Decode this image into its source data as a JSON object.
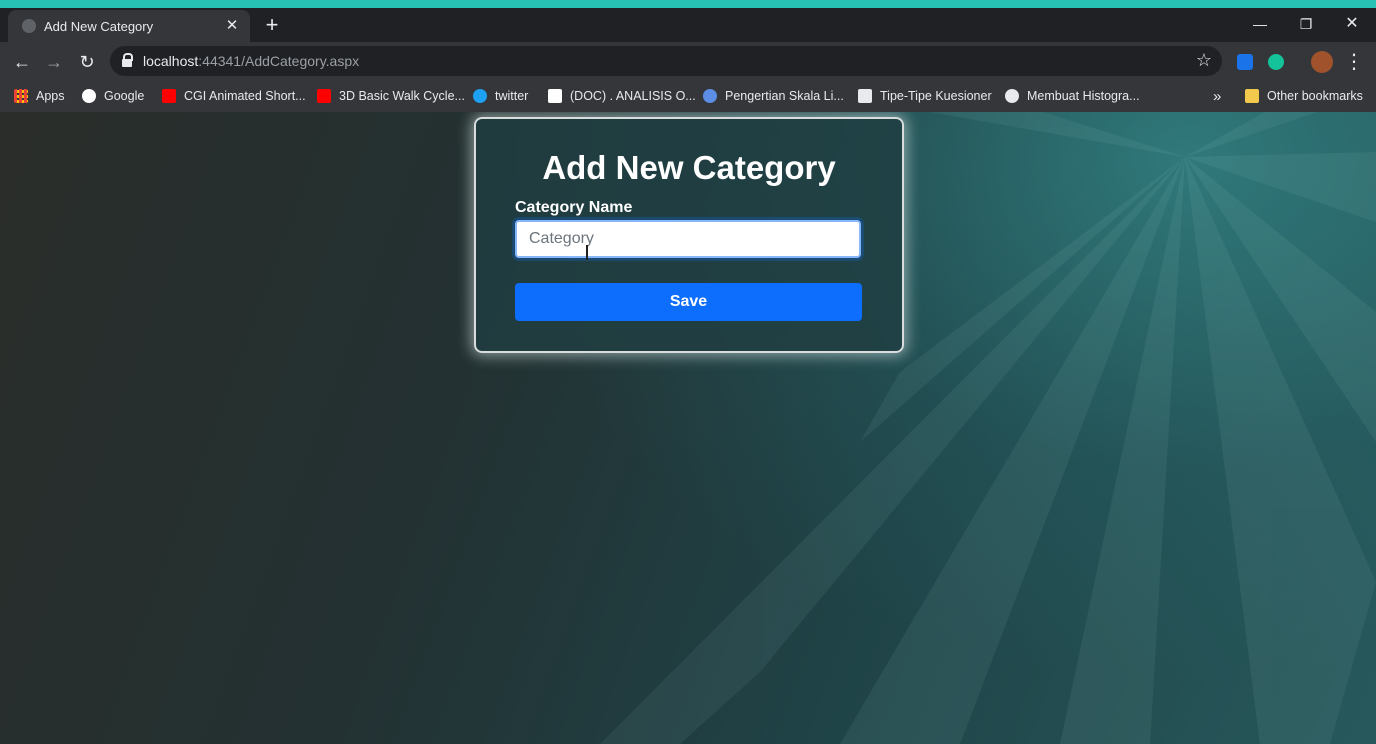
{
  "colors": {
    "top_band": "#28c2b4",
    "accent": "#0d6efd",
    "tabstrip": "#202124",
    "toolbar": "#35363a"
  },
  "browser": {
    "tab": {
      "title": "Add New Category",
      "favicon": "globe-icon",
      "close_label": "✕"
    },
    "new_tab_label": "+",
    "window_controls": {
      "minimize": "—",
      "restore": "❐",
      "close": "✕"
    },
    "nav": {
      "back": "←",
      "forward": "→",
      "reload": "↻"
    },
    "address": {
      "host": "localhost",
      "rest": ":44341/AddCategory.aspx"
    },
    "bookmark_star": "☆",
    "menu": "⋮"
  },
  "bookmarks": [
    {
      "label": "Apps",
      "icon": "apps-grid-icon",
      "color": "#4285f4"
    },
    {
      "label": "Google",
      "icon": "google-icon",
      "color": "#ffffff"
    },
    {
      "label": "CGI Animated Short...",
      "icon": "youtube-icon",
      "color": "#ff0000"
    },
    {
      "label": "3D Basic Walk Cycle...",
      "icon": "youtube-icon",
      "color": "#ff0000"
    },
    {
      "label": "twitter",
      "icon": "twitter-icon",
      "color": "#1da1f2"
    },
    {
      "label": "(DOC) . ANALISIS O...",
      "icon": "academia-icon",
      "color": "#ffffff"
    },
    {
      "label": "Pengertian Skala Li...",
      "icon": "site-icon",
      "color": "#5c8ee6"
    },
    {
      "label": "Tipe-Tipe Kuesioner",
      "icon": "site-icon",
      "color": "#e8eaed"
    },
    {
      "label": "Membuat Histogra...",
      "icon": "globe-icon",
      "color": "#e8eaed"
    }
  ],
  "bookmarks_overflow": "»",
  "other_bookmarks": "Other bookmarks",
  "form": {
    "title": "Add New Category",
    "field_label": "Category Name",
    "input_placeholder": "Category",
    "input_value": "",
    "save_label": "Save"
  }
}
